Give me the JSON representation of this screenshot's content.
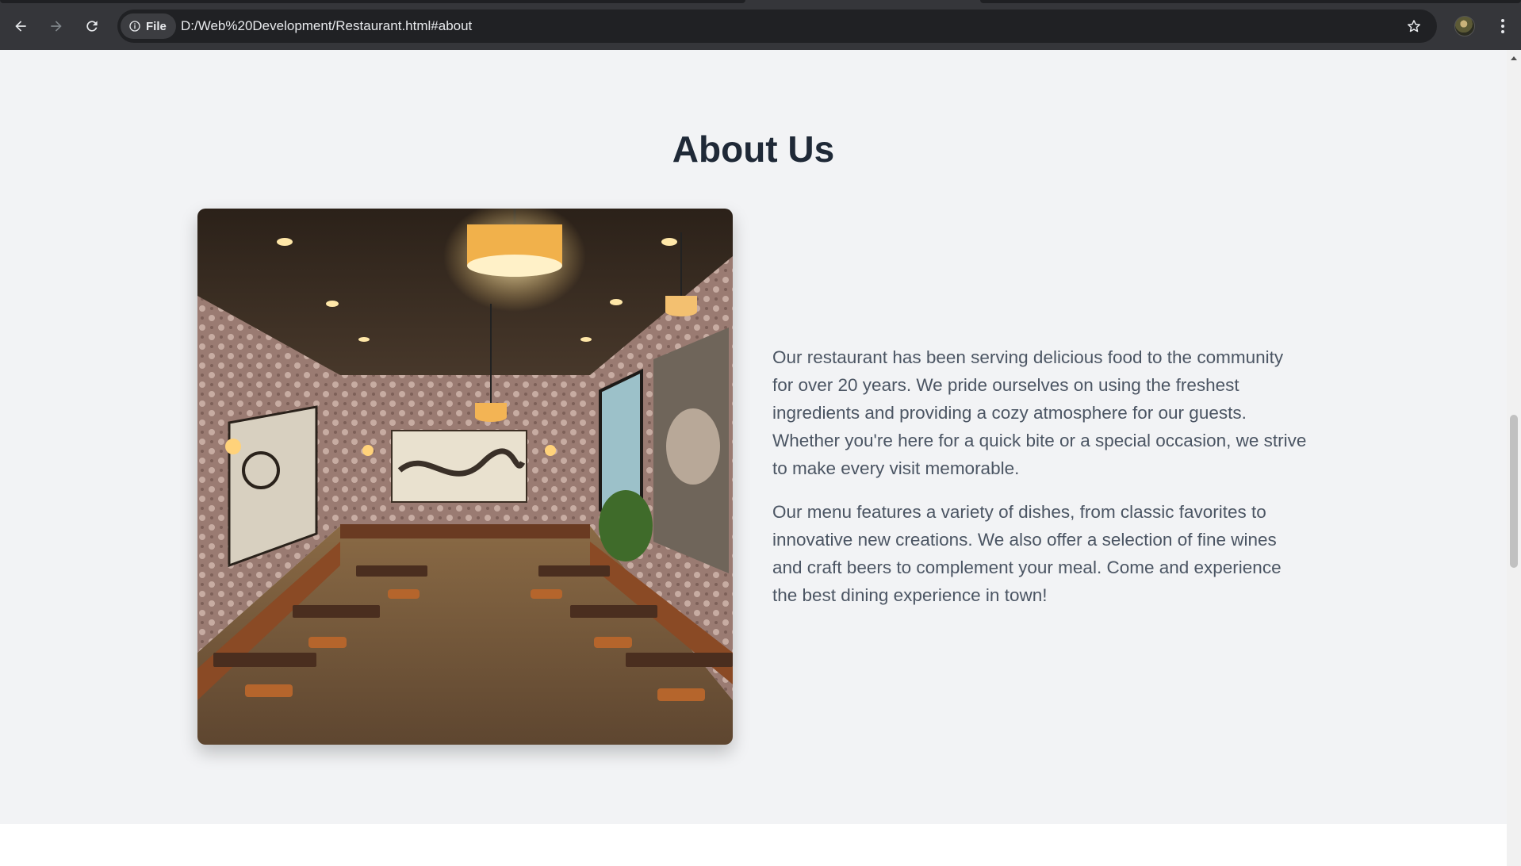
{
  "browser": {
    "site_chip_label": "File",
    "url": "D:/Web%20Development/Restaurant.html#about",
    "icons": {
      "back": "back-arrow-icon",
      "forward": "forward-arrow-icon",
      "reload": "reload-icon",
      "site_info": "info-icon",
      "bookmark": "star-icon",
      "menu": "kebab-menu-icon"
    }
  },
  "about": {
    "title": "About Us",
    "image_subject": "restaurant dining room interior",
    "paragraphs": [
      "Our restaurant has been serving delicious food to the community for over 20 years. We pride ourselves on using the freshest ingredients and providing a cozy atmosphere for our guests. Whether you're here for a quick bite or a special occasion, we strive to make every visit memorable.",
      "Our menu features a variety of dishes, from classic favorites to innovative new creations. We also offer a selection of fine wines and craft beers to complement your meal. Come and experience the best dining experience in town!"
    ]
  },
  "colors": {
    "page_background": "#f2f3f5",
    "heading": "#1f2937",
    "body_text": "#4b5563",
    "chrome": "#35363a"
  }
}
